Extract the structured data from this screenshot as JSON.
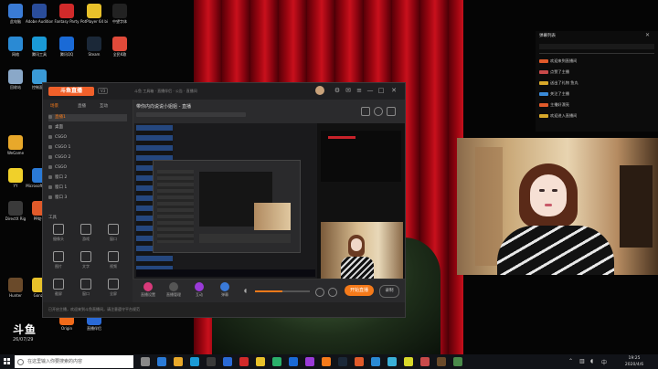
{
  "desktop": {
    "icons": [
      {
        "label": "此电脑",
        "color": "#3a7bd5"
      },
      {
        "label": "Adobe Audition CC",
        "color": "#2a4d9b"
      },
      {
        "label": "Fantasy Party",
        "color": "#d12a2a"
      },
      {
        "label": "PotPlayer 64 bit",
        "color": "#e8c12a"
      },
      {
        "label": "中望字体",
        "color": "#222"
      },
      {
        "label": "网络",
        "color": "#2a8ad4"
      },
      {
        "label": "腾讯工具",
        "color": "#1a9ad6"
      },
      {
        "label": "腾讯QQ",
        "color": "#1a6ad6"
      },
      {
        "label": "Steam",
        "color": "#1b2838"
      },
      {
        "label": "全民K歌",
        "color": "#e04a3a"
      },
      {
        "label": "回收站",
        "color": "#8aa8c8"
      },
      {
        "label": "控制面板",
        "color": "#3a9ad6"
      },
      {
        "label": "WeGame",
        "color": "#e8a82a"
      },
      {
        "label": "YY",
        "color": "#f0d02a"
      },
      {
        "label": "Microsoft Edge",
        "color": "#2a7ad6"
      },
      {
        "label": "DirectX Rig",
        "color": "#3a3a3a"
      },
      {
        "label": "PP助手",
        "color": "#e05a2a"
      },
      {
        "label": "Hunter",
        "color": "#6a4a2a"
      },
      {
        "label": "Gonzo",
        "color": "#e8c22a"
      },
      {
        "label": "Origin",
        "color": "#f06a1a"
      },
      {
        "label": "直播伴侣",
        "color": "#2a6ad6"
      }
    ]
  },
  "app": {
    "logo": "斗鱼直播",
    "version": "V3",
    "notice": "斗鱼 工具箱 · 直播伴侣 · 公告 · 直播间",
    "title": "带你内向说说小姐姐 - 直播",
    "tabs": [
      "场景",
      "直播",
      "互动"
    ],
    "scenes": [
      "直播1",
      "桌面",
      "CSGO",
      "CSGO 1",
      "CSGO 2",
      "CSGO",
      "窗口 2",
      "窗口 1",
      "窗口 3"
    ],
    "tools_title": "工具",
    "tools": [
      "摄像头",
      "游戏",
      "窗口",
      "图片",
      "文字",
      "视频",
      "截屏",
      "窗口",
      "全屏"
    ],
    "bottom_buttons": [
      "直播设置",
      "直播管理",
      "互动",
      "弹幕"
    ],
    "go_live": "开始直播",
    "record": "录制",
    "footer": "已开启主播，欢迎来到斗鱼直播间，请注意遵守平台规范"
  },
  "chat": {
    "header": "弹幕列表",
    "messages": [
      "欢迎来到直播间",
      "点赞了主播",
      "送出了礼物 鱼丸",
      "关注了主播",
      "主播好漂亮",
      "欢迎进入直播间"
    ]
  },
  "watermark": {
    "brand": "斗鱼",
    "time": "26/07/29"
  },
  "taskbar": {
    "search_placeholder": "在这里输入你要搜索的内容",
    "time": "19:25",
    "date": "2020/4/6"
  },
  "colors": {
    "accent": "#f57a1a",
    "curtain": "#b00814",
    "taskbar": "#111318"
  }
}
